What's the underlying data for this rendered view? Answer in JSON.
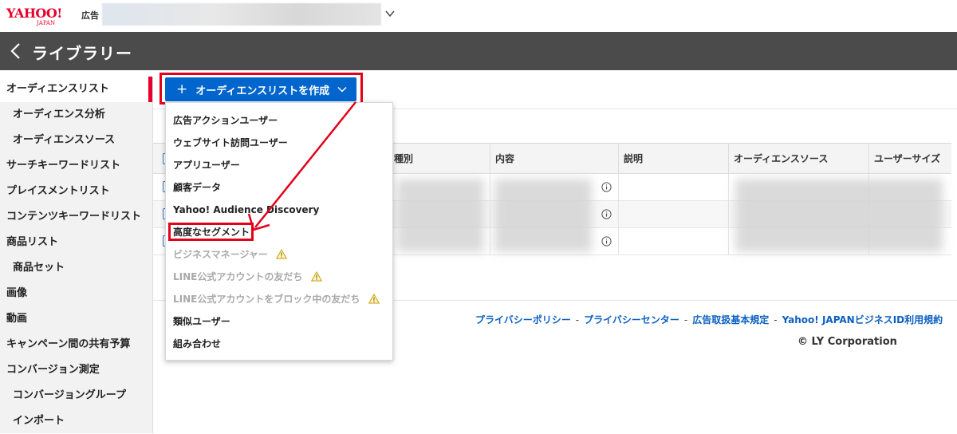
{
  "header": {
    "logo_text": "YAHOO!",
    "logo_sub": "JAPAN",
    "logo_label": "広告",
    "account_icon": "chevron-down-icon"
  },
  "titlebar": {
    "title": "ライブラリー",
    "back_icon": "chevron-left-icon"
  },
  "sidebar": {
    "items": [
      {
        "label": "オーディエンスリスト",
        "sub": false,
        "active": true
      },
      {
        "label": "オーディエンス分析",
        "sub": true
      },
      {
        "label": "オーディエンスソース",
        "sub": true
      },
      {
        "label": "サーチキーワードリスト",
        "sub": false
      },
      {
        "label": "プレイスメントリスト",
        "sub": false
      },
      {
        "label": "コンテンツキーワードリスト",
        "sub": false
      },
      {
        "label": "商品リスト",
        "sub": false
      },
      {
        "label": "商品セット",
        "sub": true
      },
      {
        "label": "画像",
        "sub": false
      },
      {
        "label": "動画",
        "sub": false
      },
      {
        "label": "キャンペーン間の共有予算",
        "sub": false
      },
      {
        "label": "コンバージョン測定",
        "sub": false
      },
      {
        "label": "コンバージョングループ",
        "sub": true
      },
      {
        "label": "インポート",
        "sub": true
      }
    ],
    "accent_color": "#e5002b"
  },
  "toolbar": {
    "create_button_label": "オーディエンスリストを作成",
    "create_button_color": "#0065cc"
  },
  "table": {
    "columns": [
      "種別",
      "内容",
      "説明",
      "オーディエンスソース",
      "ユーザーサイズ"
    ]
  },
  "dropdown": {
    "items": [
      {
        "label": "広告アクションユーザー",
        "disabled": false,
        "warning": false
      },
      {
        "label": "ウェブサイト訪問ユーザー",
        "disabled": false,
        "warning": false
      },
      {
        "label": "アプリユーザー",
        "disabled": false,
        "warning": false
      },
      {
        "label": "顧客データ",
        "disabled": false,
        "warning": false
      },
      {
        "label": "Yahoo! Audience Discovery",
        "disabled": false,
        "warning": false
      },
      {
        "label": "高度なセグメント",
        "disabled": false,
        "warning": false,
        "highlighted": true
      },
      {
        "label": "ビジネスマネージャー",
        "disabled": true,
        "warning": true
      },
      {
        "label": "LINE公式アカウントの友だち",
        "disabled": true,
        "warning": true
      },
      {
        "label": "LINE公式アカウントをブロック中の友だち",
        "disabled": true,
        "warning": true
      },
      {
        "label": "類似ユーザー",
        "disabled": false,
        "warning": false
      },
      {
        "label": "組み合わせ",
        "disabled": false,
        "warning": false
      }
    ]
  },
  "footer": {
    "links": [
      "プライバシーポリシー",
      "プライバシーセンター",
      "広告取扱基本規定",
      "Yahoo! JAPANビジネスID利用規約"
    ],
    "separator": "-",
    "copyright": "© LY Corporation",
    "link_color": "#0b5fc2"
  },
  "annotation_color": "#e3001b"
}
